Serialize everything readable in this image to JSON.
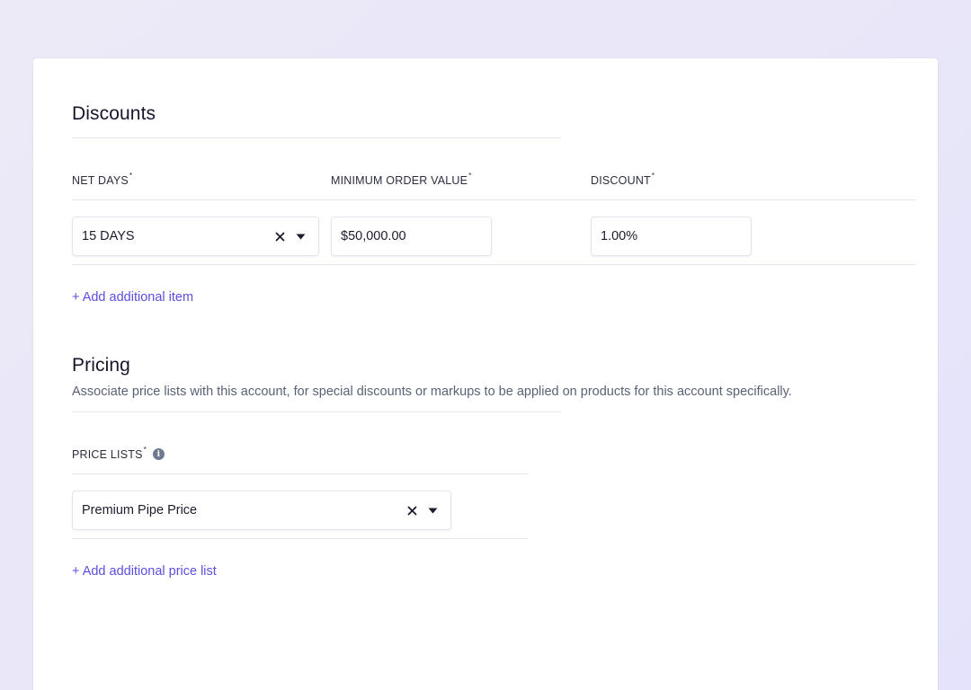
{
  "discounts": {
    "title": "Discounts",
    "columns": {
      "net_days": "NET DAYS",
      "min_order": "MINIMUM ORDER VALUE",
      "discount": "DISCOUNT",
      "required_mark": "*"
    },
    "row": {
      "net_days_value": "15 DAYS",
      "min_order_value": "$50,000.00",
      "discount_value": "1.00%"
    },
    "add_link": "+ Add additional item"
  },
  "pricing": {
    "title": "Pricing",
    "description": "Associate price lists with this account, for special discounts or markups to be applied on products for this account specifically.",
    "price_lists_label": "PRICE LISTS",
    "required_mark": "*",
    "info_glyph": "i",
    "price_list_value": "Premium Pipe Price",
    "add_link": "+ Add additional price list"
  },
  "icons": {
    "clear": "close-icon",
    "dropdown": "caret-down-icon",
    "info": "info-icon"
  },
  "colors": {
    "accent": "#5a4fe0",
    "background": "#ebe9f8",
    "card": "#ffffff"
  }
}
